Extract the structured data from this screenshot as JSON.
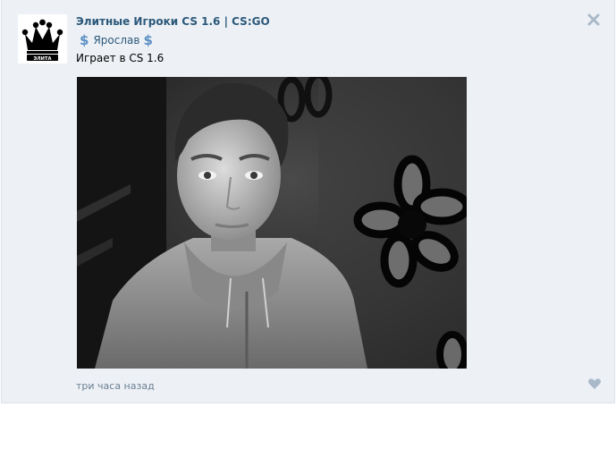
{
  "post": {
    "group_name": "Элитные Игроки CS 1.6 | CS:GO",
    "author_prefix": "$",
    "author_name": "Ярослав",
    "author_suffix": "$",
    "status": "Играет в CS 1.6",
    "timestamp": "три часа назад",
    "avatar_label": "ЭЛИТА"
  },
  "icons": {
    "close": "close-icon",
    "like": "heart-icon",
    "avatar": "crown-icon"
  },
  "colors": {
    "background": "#edf1f5",
    "link": "#2b587a",
    "dollar": "#5b8fc4",
    "muted": "#6b7f94",
    "icon": "#aab9c9"
  }
}
